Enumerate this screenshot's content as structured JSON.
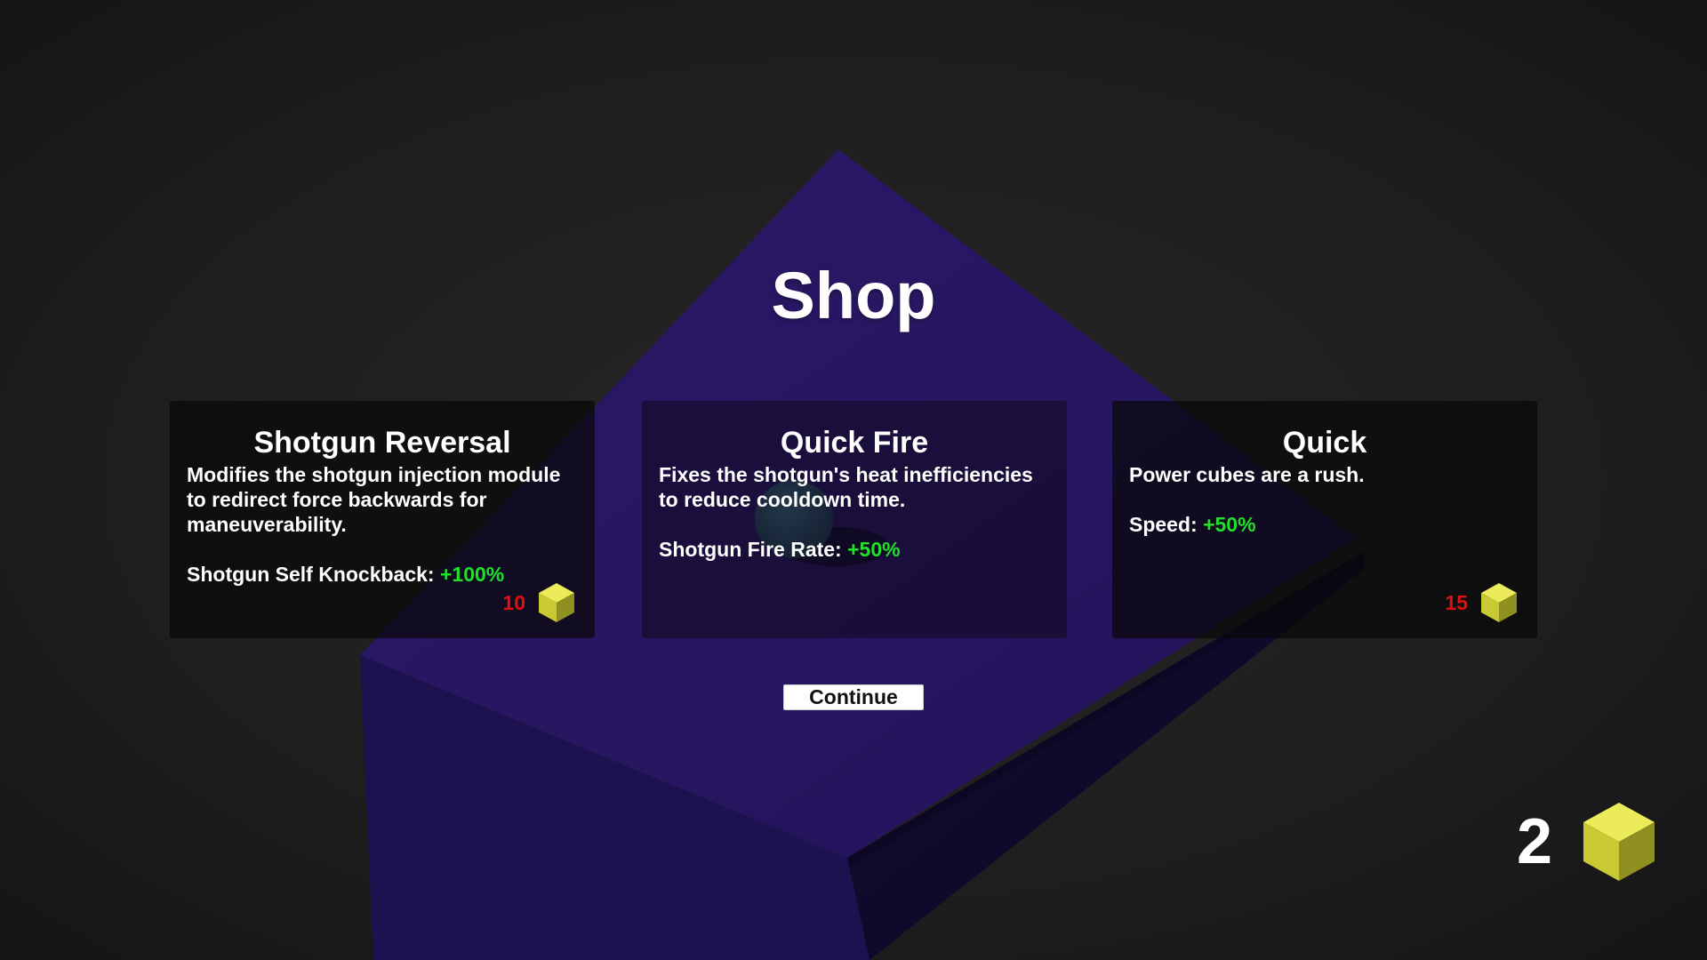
{
  "title": "Shop",
  "colors": {
    "background": "#1e1e1e",
    "platform_top": "#2a1763",
    "platform_side": "#170e3c",
    "stat_positive": "#22e02a",
    "price": "#e01010",
    "cube": "#d4d43a"
  },
  "cards": [
    {
      "name": "Shotgun Reversal",
      "description": "Modifies the shotgun injection module to redirect force backwards for maneuverability.",
      "stat_label": "Shotgun Self Knockback:",
      "stat_value": "+100%",
      "price": "10",
      "icon": "power-cube-icon"
    },
    {
      "name": "Quick Fire",
      "description": "Fixes the shotgun's heat inefficiencies to reduce cooldown time.",
      "stat_label": "Shotgun Fire Rate:",
      "stat_value": "+50%",
      "price": "",
      "icon": ""
    },
    {
      "name": "Quick",
      "description": "Power cubes are a rush.",
      "stat_label": "Speed:",
      "stat_value": "+50%",
      "price": "15",
      "icon": "power-cube-icon"
    }
  ],
  "continue_label": "Continue",
  "currency": {
    "count": "2",
    "icon": "power-cube-icon"
  }
}
